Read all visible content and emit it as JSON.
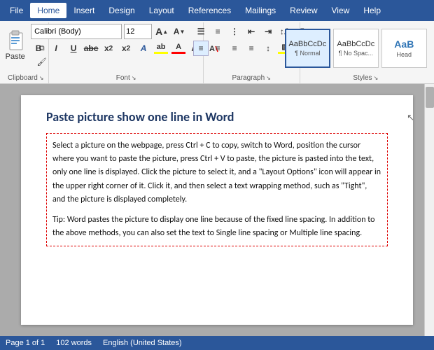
{
  "menubar": {
    "items": [
      "File",
      "Home",
      "Insert",
      "Design",
      "Layout",
      "References",
      "Mailings",
      "Review",
      "View",
      "Help"
    ]
  },
  "ribbon": {
    "active_tab": "Home",
    "groups": {
      "clipboard": {
        "label": "Clipboard",
        "paste_label": "Paste"
      },
      "font": {
        "label": "Font",
        "font_name": "Calibri (Body)",
        "font_size": "12",
        "bold": "B",
        "italic": "I",
        "underline": "U",
        "strikethrough": "abc",
        "subscript": "x₂",
        "superscript": "x²",
        "grow": "A",
        "shrink": "A"
      },
      "paragraph": {
        "label": "Paragraph"
      },
      "styles": {
        "label": "Styles",
        "items": [
          {
            "preview": "AaBbCcDc",
            "name": "¶ Normal",
            "active": true
          },
          {
            "preview": "AaBbCcDc",
            "name": "¶ No Spac...",
            "active": false
          },
          {
            "preview": "AaB",
            "name": "Head",
            "active": false
          }
        ]
      }
    }
  },
  "document": {
    "title": "Paste picture show one line in Word",
    "paragraphs": [
      "Select a picture on the webpage, press Ctrl + C to copy, switch to Word, position the cursor where you want to paste the picture, press Ctrl + V to paste, the picture is pasted into the text, only one line is displayed. Click the picture to select it, and a \"Layout Options\" icon will appear in the upper right corner of it. Click it, and then select a text wrapping method, such as \"Tight\", and the picture is displayed completely.",
      "Tip: Word pastes the picture to display one line because of the fixed line spacing. In addition to the above methods, you can also set the text to Single line spacing or Multiple line spacing."
    ]
  },
  "statusbar": {
    "page": "Page 1 of 1",
    "words": "102 words",
    "language": "English (United States)"
  }
}
